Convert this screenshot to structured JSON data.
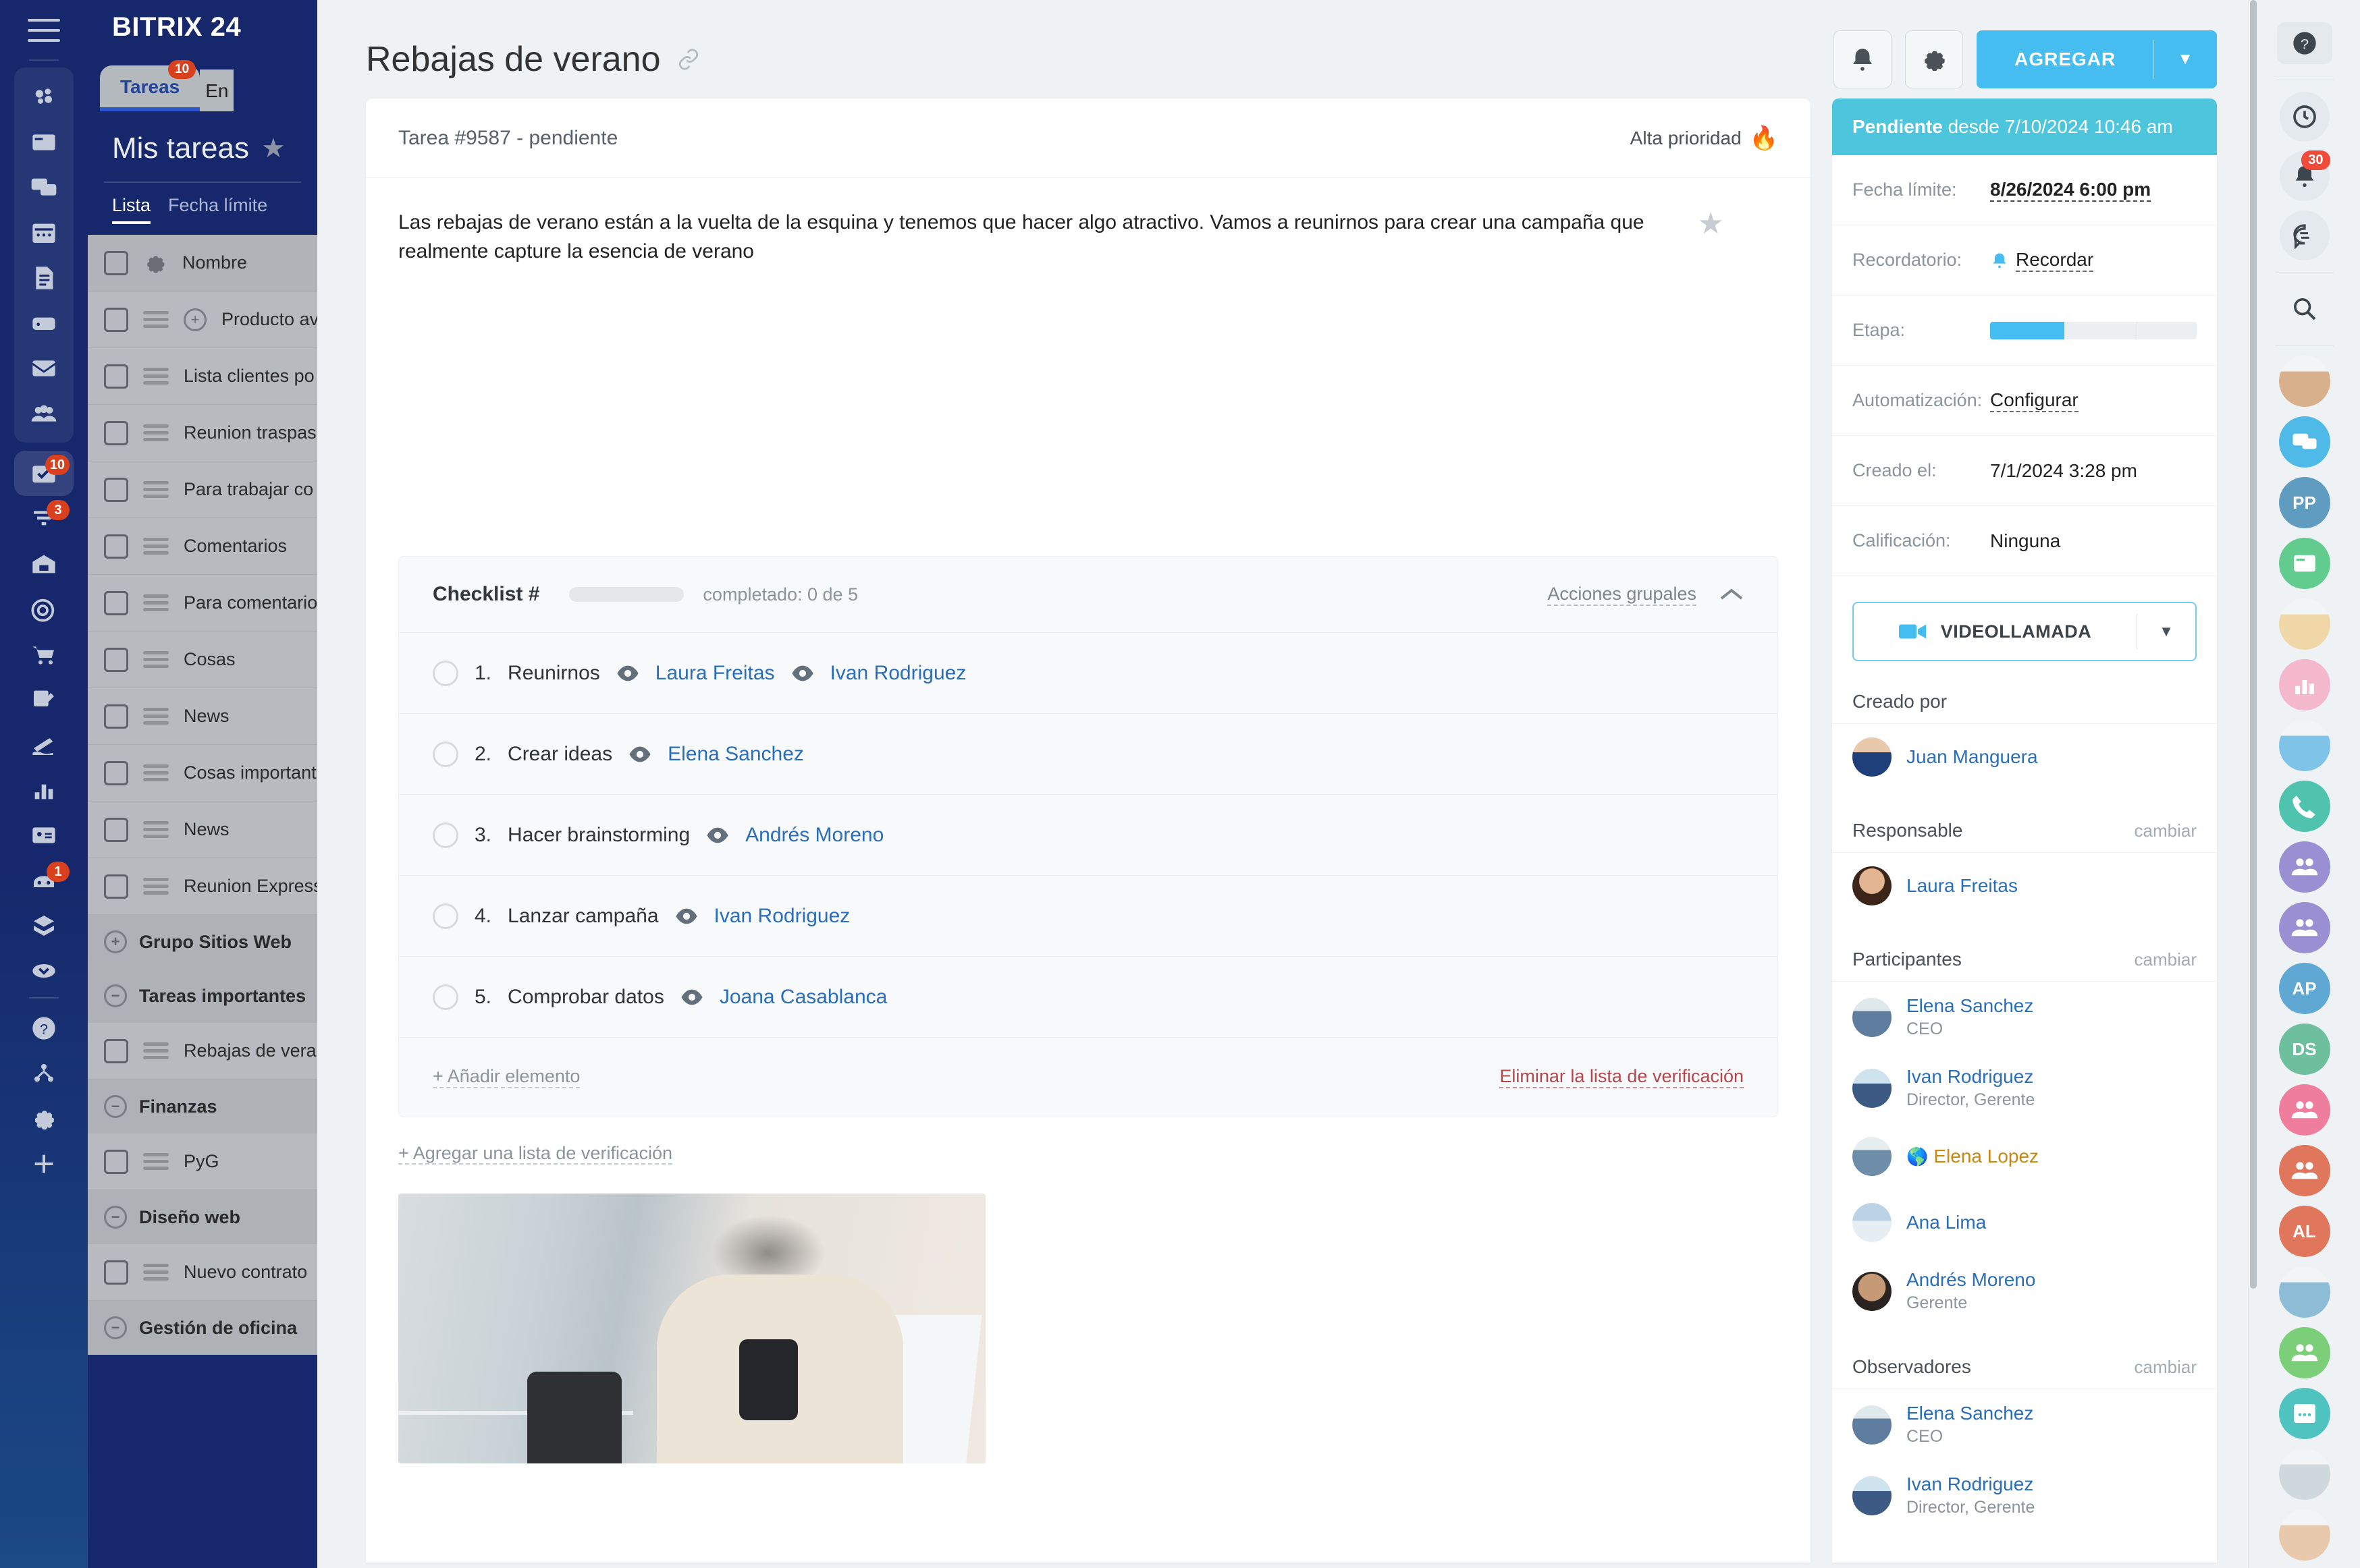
{
  "brand": {
    "logo": "BITRIX 24"
  },
  "left_rail": {
    "items": [
      {
        "name": "feed-icon",
        "badge": ""
      },
      {
        "name": "crm-card-icon",
        "badge": ""
      },
      {
        "name": "chat-icon",
        "badge": ""
      },
      {
        "name": "calendar-icon",
        "badge": ""
      },
      {
        "name": "documents-icon",
        "badge": ""
      },
      {
        "name": "drive-icon",
        "badge": ""
      },
      {
        "name": "mail-icon",
        "badge": ""
      },
      {
        "name": "group-icon",
        "badge": ""
      },
      {
        "name": "tasks-icon",
        "badge": "10"
      },
      {
        "name": "funnel-icon",
        "badge": "3"
      },
      {
        "name": "company-icon",
        "badge": ""
      },
      {
        "name": "target-icon",
        "badge": ""
      },
      {
        "name": "shop-icon",
        "badge": ""
      },
      {
        "name": "signature-icon",
        "badge": ""
      },
      {
        "name": "marketing-icon",
        "badge": ""
      },
      {
        "name": "analytics-icon",
        "badge": ""
      },
      {
        "name": "contact-card-icon",
        "badge": ""
      },
      {
        "name": "automation-bot-icon",
        "badge": "1"
      },
      {
        "name": "market-box-icon",
        "badge": ""
      },
      {
        "name": "more-chevron-icon",
        "badge": ""
      },
      {
        "name": "help-icon",
        "badge": ""
      },
      {
        "name": "sitemap-icon",
        "badge": ""
      },
      {
        "name": "settings-icon",
        "badge": ""
      },
      {
        "name": "add-icon",
        "badge": ""
      }
    ]
  },
  "left_panel": {
    "tabs": [
      {
        "label": "Tareas",
        "badge": "10",
        "active": true
      },
      {
        "label": "En",
        "badge": "",
        "active": false
      }
    ],
    "title": "Mis tareas",
    "subtabs": [
      {
        "label": "Lista",
        "active": true
      },
      {
        "label": "Fecha límite",
        "active": false
      }
    ],
    "column_header": "Nombre",
    "rows": [
      {
        "label": "Producto avan",
        "plus": true
      },
      {
        "label": "Lista clientes po",
        "plus": false
      },
      {
        "label": "Reunion traspas",
        "plus": false
      },
      {
        "label": "Para trabajar co",
        "plus": false
      },
      {
        "label": "Comentarios",
        "plus": false
      },
      {
        "label": "Para comentario",
        "plus": false
      },
      {
        "label": "Cosas",
        "plus": false
      },
      {
        "label": "News",
        "plus": false
      },
      {
        "label": "Cosas important",
        "plus": false
      },
      {
        "label": "News",
        "plus": false
      },
      {
        "label": "Reunion Express",
        "plus": false
      }
    ],
    "groups": [
      {
        "label": "Grupo Sitios Web",
        "toggle": "+",
        "rows": []
      },
      {
        "label": "Tareas importantes",
        "toggle": "−",
        "rows": [
          "Rebajas de vera"
        ]
      },
      {
        "label": "Finanzas",
        "toggle": "−",
        "rows": [
          "PyG"
        ]
      },
      {
        "label": "Diseño web",
        "toggle": "−",
        "rows": [
          "Nuevo contrato"
        ]
      },
      {
        "label": "Gestión de oficina",
        "toggle": "−",
        "rows": []
      }
    ]
  },
  "header": {
    "title": "Rebajas de verano",
    "link_icon": "link-icon",
    "bell_button": "bell-icon",
    "settings_button": "gear-icon",
    "add_button": "AGREGAR",
    "add_caret": "▼"
  },
  "task": {
    "number_status": "Tarea #9587 - pendiente",
    "priority": "Alta prioridad",
    "priority_icon": "🔥",
    "description": "Las rebajas de verano están a la vuelta de la esquina y tenemos que hacer algo atractivo. Vamos a reunirnos para crear una campaña que realmente capture la esencia de verano"
  },
  "checklist": {
    "title": "Checklist #",
    "progress_label": "completado: 0 de 5",
    "progress_value": 0,
    "progress_total": 5,
    "group_actions": "Acciones grupales",
    "items": [
      {
        "num": "1.",
        "text": "Reunirnos",
        "users": [
          "Laura Freitas",
          "Ivan Rodriguez"
        ]
      },
      {
        "num": "2.",
        "text": "Crear ideas",
        "users": [
          "Elena Sanchez"
        ]
      },
      {
        "num": "3.",
        "text": "Hacer brainstorming",
        "users": [
          "Andrés Moreno"
        ]
      },
      {
        "num": "4.",
        "text": "Lanzar campaña",
        "users": [
          "Ivan Rodriguez"
        ]
      },
      {
        "num": "5.",
        "text": "Comprobar datos",
        "users": [
          "Joana Casablanca"
        ]
      }
    ],
    "add_item": "+ Añadir elemento",
    "delete_list": "Eliminar la lista de verificación",
    "add_checklist": "+ Agregar una lista de verificación"
  },
  "side": {
    "status_strong": "Pendiente",
    "status_rest": " desde 7/10/2024 10:46 am",
    "fields": [
      {
        "key": "Fecha límite:",
        "value": "8/26/2024 6:00 pm",
        "type": "bold-dashed"
      },
      {
        "key": "Recordatorio:",
        "value": "Recordar",
        "type": "bell-dashed"
      },
      {
        "key": "Etapa:",
        "value": "",
        "type": "progress"
      },
      {
        "key": "Automatización:",
        "value": "Configurar",
        "type": "dashed"
      },
      {
        "key": "Creado el:",
        "value": "7/1/2024 3:28 pm",
        "type": "plain"
      },
      {
        "key": "Calificación:",
        "value": "Ninguna",
        "type": "plain"
      }
    ],
    "stage_percent": 36,
    "videocall_label": "VIDEOLLAMADA",
    "videocall_caret": "▼",
    "created_by_label": "Creado por",
    "created_by": {
      "name": "Juan Manguera",
      "position": ""
    },
    "responsible_label": "Responsable",
    "responsible_change": "cambiar",
    "responsible": {
      "name": "Laura Freitas",
      "position": ""
    },
    "participants_label": "Participantes",
    "participants_change": "cambiar",
    "participants": [
      {
        "name": "Elena Sanchez",
        "position": "CEO",
        "crown": false
      },
      {
        "name": "Ivan Rodriguez",
        "position": "Director, Gerente",
        "crown": false
      },
      {
        "name": "Elena Lopez",
        "position": "",
        "crown": true
      },
      {
        "name": "Ana Lima",
        "position": "",
        "crown": false
      },
      {
        "name": "Andrés Moreno",
        "position": "Gerente",
        "crown": false
      }
    ],
    "observers_label": "Observadores",
    "observers_change": "cambiar",
    "observers": [
      {
        "name": "Elena Sanchez",
        "position": "CEO",
        "crown": false
      },
      {
        "name": "Ivan Rodriguez",
        "position": "Director, Gerente",
        "crown": false
      }
    ]
  },
  "right_rail": {
    "items": [
      {
        "name": "help-icon",
        "badge": "",
        "shape": "chip"
      },
      {
        "name": "sep",
        "badge": "",
        "shape": "sep"
      },
      {
        "name": "timeman-icon",
        "badge": "",
        "shape": "round"
      },
      {
        "name": "notifications-bell-icon",
        "badge": "30",
        "shape": "round"
      },
      {
        "name": "chat-sync-icon",
        "badge": "",
        "shape": "round"
      },
      {
        "name": "sep",
        "badge": "",
        "shape": "sep"
      },
      {
        "name": "search-icon",
        "badge": "",
        "shape": "plain"
      },
      {
        "name": "sep",
        "badge": "",
        "shape": "sep"
      }
    ],
    "avatars": [
      {
        "name": "avatar-photo-woman-1",
        "kind": "photo",
        "color": "#d9b08c",
        "initials": ""
      },
      {
        "name": "avatar-chat-group",
        "kind": "icon-chat",
        "color": "#4fb9e8",
        "initials": ""
      },
      {
        "name": "avatar-initials-pp",
        "kind": "initials",
        "color": "#5f9cbf",
        "initials": "PP"
      },
      {
        "name": "avatar-news-feed",
        "kind": "icon-news",
        "color": "#62cc8f",
        "initials": ""
      },
      {
        "name": "avatar-photo-woman-2",
        "kind": "photo",
        "color": "#f0d7a8",
        "initials": ""
      },
      {
        "name": "avatar-chart-pink",
        "kind": "icon-chart",
        "color": "#f4b8cd",
        "initials": ""
      },
      {
        "name": "avatar-photo-man-1",
        "kind": "photo",
        "color": "#7fc3e8",
        "initials": ""
      },
      {
        "name": "avatar-call-group",
        "kind": "icon-call",
        "color": "#4fc3ae",
        "initials": ""
      },
      {
        "name": "avatar-group-purple-1",
        "kind": "icon-group",
        "color": "#9b8fd4",
        "initials": ""
      },
      {
        "name": "avatar-group-purple-2",
        "kind": "icon-group",
        "color": "#9b8fd4",
        "initials": ""
      },
      {
        "name": "avatar-initials-ap",
        "kind": "initials",
        "color": "#5fa8d3",
        "initials": "AP"
      },
      {
        "name": "avatar-initials-ds",
        "kind": "initials",
        "color": "#6ebf9e",
        "initials": "DS"
      },
      {
        "name": "avatar-group-pink",
        "kind": "icon-group",
        "color": "#ef7d9e",
        "initials": ""
      },
      {
        "name": "avatar-group-orange",
        "kind": "icon-group",
        "color": "#e0765c",
        "initials": ""
      },
      {
        "name": "avatar-initials-al",
        "kind": "initials",
        "color": "#e0765c",
        "initials": "AL"
      },
      {
        "name": "avatar-photo-man-2",
        "kind": "photo",
        "color": "#8cbcd6",
        "initials": ""
      },
      {
        "name": "avatar-group-green",
        "kind": "icon-group",
        "color": "#7bcf78",
        "initials": ""
      },
      {
        "name": "avatar-calendar-teal",
        "kind": "icon-cal",
        "color": "#4fc3c0",
        "initials": ""
      },
      {
        "name": "avatar-photo-woman-3",
        "kind": "photo",
        "color": "#cfd8dc",
        "initials": ""
      },
      {
        "name": "avatar-photo-woman-4",
        "kind": "photo",
        "color": "#e8c9ac",
        "initials": ""
      }
    ]
  }
}
